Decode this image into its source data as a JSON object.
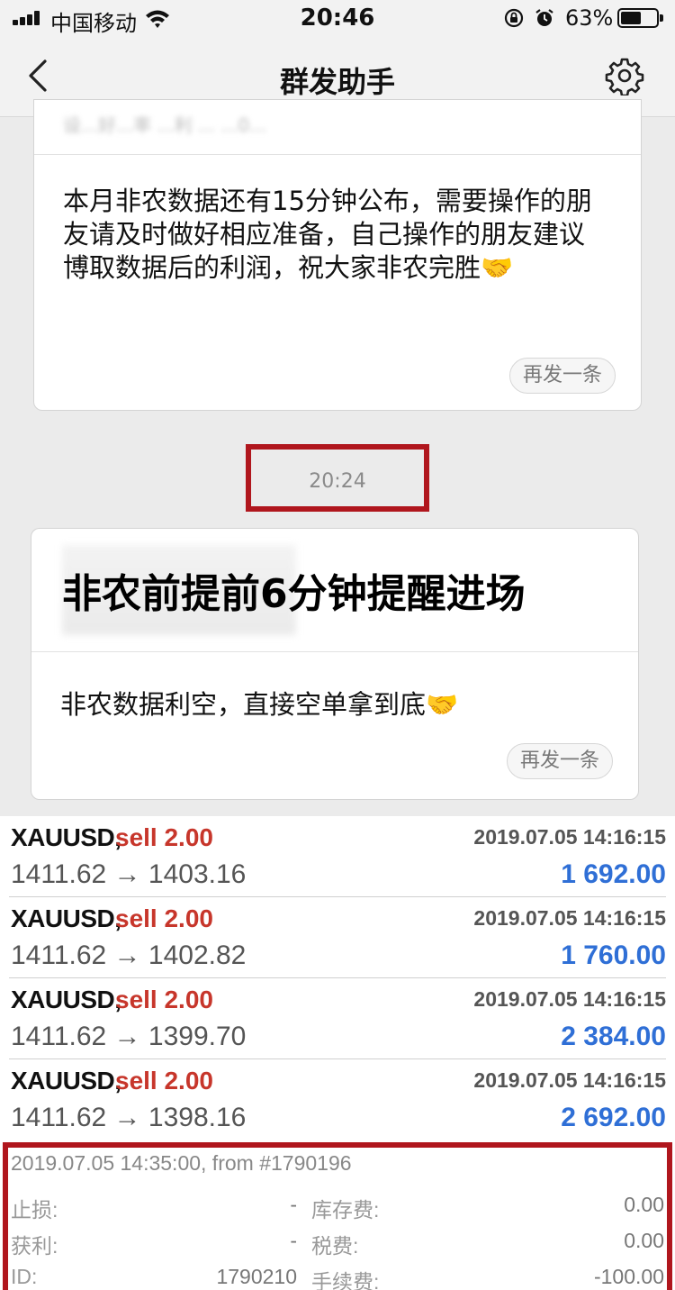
{
  "status_bar": {
    "carrier": "中国移动",
    "time": "20:46",
    "battery": "63%",
    "battery_level": 0.63
  },
  "nav": {
    "title": "群发助手"
  },
  "messages": [
    {
      "preview": "设...好...率 ...利 ... ...0...",
      "text": "本月非农数据还有15分钟公布，需要操作的朋友请及时做好相应准备，自己操作的朋友建议博取数据后的利润，祝大家非农完胜🤝",
      "resend_label": "再发一条"
    },
    {
      "timestamp": "20:24",
      "headline": "非农前提前6分钟提醒进场",
      "text": "非农数据利空，直接空单拿到底🤝",
      "resend_label": "再发一条"
    }
  ],
  "trades": [
    {
      "symbol": "XAUUSD,",
      "side": "sell 2.00",
      "time": "2019.07.05 14:16:15",
      "prices": "1411.62 → 1403.16",
      "profit": "1 692.00"
    },
    {
      "symbol": "XAUUSD,",
      "side": "sell 2.00",
      "time": "2019.07.05 14:16:15",
      "prices": "1411.62 → 1402.82",
      "profit": "1 760.00"
    },
    {
      "symbol": "XAUUSD,",
      "side": "sell 2.00",
      "time": "2019.07.05 14:16:15",
      "prices": "1411.62 → 1399.70",
      "profit": "2 384.00"
    },
    {
      "symbol": "XAUUSD,",
      "side": "sell 2.00",
      "time": "2019.07.05 14:16:15",
      "prices": "1411.62 → 1398.16",
      "profit": "2 692.00"
    }
  ],
  "detail": {
    "header": "2019.07.05 14:35:00, from #1790196",
    "rows": [
      {
        "left_label": "止损:",
        "left_value": "-",
        "right_label": "库存费:",
        "right_value": "0.00"
      },
      {
        "left_label": "获利:",
        "left_value": "-",
        "right_label": "税费:",
        "right_value": "0.00"
      },
      {
        "left_label": "ID:",
        "left_value": "1790210",
        "right_label": "手续费:",
        "right_value": "-100.00"
      }
    ]
  },
  "colors": {
    "sell": "#c7362b",
    "profit": "#2f6fd6",
    "highlight_frame": "#b0161d"
  }
}
